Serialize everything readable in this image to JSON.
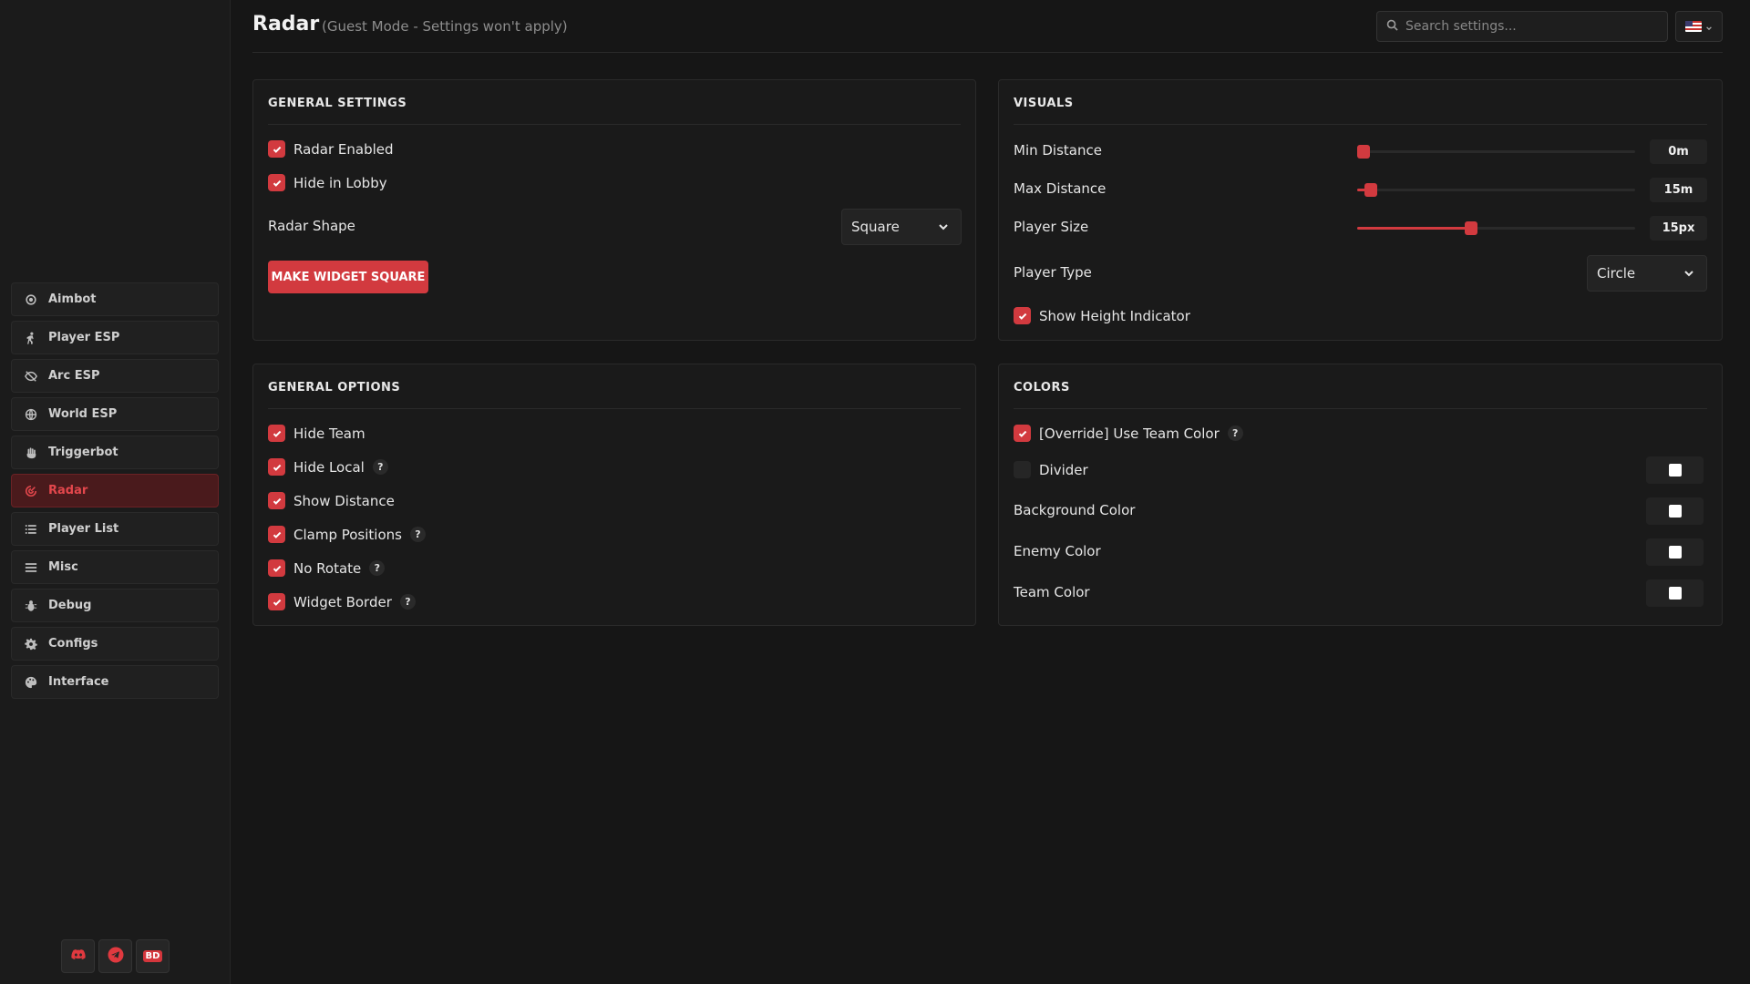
{
  "page": {
    "title": "Radar",
    "subtitle": "(Guest Mode - Settings won't apply)"
  },
  "search": {
    "placeholder": "Search settings..."
  },
  "language": {
    "icon": "us-flag-icon"
  },
  "sidebar": {
    "items": [
      {
        "label": "Aimbot",
        "icon": "crosshair-icon",
        "active": false
      },
      {
        "label": "Player ESP",
        "icon": "person-walking-icon",
        "active": false
      },
      {
        "label": "Arc ESP",
        "icon": "eye-slash-icon",
        "active": false
      },
      {
        "label": "World ESP",
        "icon": "globe-icon",
        "active": false
      },
      {
        "label": "Triggerbot",
        "icon": "hand-icon",
        "active": false
      },
      {
        "label": "Radar",
        "icon": "radar-icon",
        "active": true
      },
      {
        "label": "Player List",
        "icon": "list-icon",
        "active": false
      },
      {
        "label": "Misc",
        "icon": "menu-icon",
        "active": false
      },
      {
        "label": "Debug",
        "icon": "bug-icon",
        "active": false
      },
      {
        "label": "Configs",
        "icon": "gear-icon",
        "active": false
      },
      {
        "label": "Interface",
        "icon": "palette-icon",
        "active": false
      }
    ],
    "socials": [
      {
        "icon": "discord-icon"
      },
      {
        "icon": "telegram-icon"
      },
      {
        "label": "BD",
        "icon": "bd-logo-icon"
      }
    ]
  },
  "general_settings": {
    "title": "GENERAL SETTINGS",
    "radar_enabled": {
      "label": "Radar Enabled",
      "checked": true
    },
    "hide_in_lobby": {
      "label": "Hide in Lobby",
      "checked": true
    },
    "radar_shape": {
      "label": "Radar Shape",
      "value": "Square"
    },
    "make_square_button": "MAKE WIDGET SQUARE"
  },
  "visuals": {
    "title": "VISUALS",
    "min_distance": {
      "label": "Min Distance",
      "value": "0m",
      "fraction": 0.02
    },
    "max_distance": {
      "label": "Max Distance",
      "value": "15m",
      "fraction": 0.05
    },
    "player_size": {
      "label": "Player Size",
      "value": "15px",
      "fraction": 0.41
    },
    "player_type": {
      "label": "Player Type",
      "value": "Circle"
    },
    "show_height_indicator": {
      "label": "Show Height Indicator",
      "checked": true
    }
  },
  "general_options": {
    "title": "GENERAL OPTIONS",
    "items": [
      {
        "label": "Hide Team",
        "checked": true,
        "help": false
      },
      {
        "label": "Hide Local",
        "checked": true,
        "help": true
      },
      {
        "label": "Show Distance",
        "checked": true,
        "help": false
      },
      {
        "label": "Clamp Positions",
        "checked": true,
        "help": true
      },
      {
        "label": "No Rotate",
        "checked": true,
        "help": true
      },
      {
        "label": "Widget Border",
        "checked": true,
        "help": true
      }
    ],
    "help_glyph": "?"
  },
  "colors": {
    "title": "COLORS",
    "override_team_color": {
      "label": "[Override] Use Team Color",
      "checked": true
    },
    "divider": {
      "label": "Divider",
      "checked": false,
      "color": "#ffffff"
    },
    "background_color": {
      "label": "Background Color",
      "color": "#ffffff"
    },
    "enemy_color": {
      "label": "Enemy Color",
      "color": "#ffffff"
    },
    "team_color": {
      "label": "Team Color",
      "color": "#ffffff"
    }
  },
  "theme": {
    "accent": "#d23a3f",
    "background": "#161616",
    "panel": "#1a1a1a"
  }
}
